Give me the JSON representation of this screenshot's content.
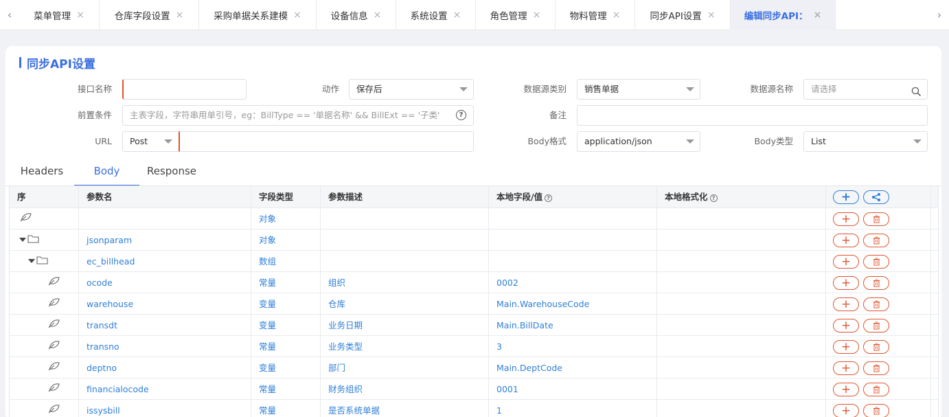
{
  "tabs": [
    {
      "label": "菜单管理",
      "active": false
    },
    {
      "label": "仓库字段设置",
      "active": false
    },
    {
      "label": "采购单据关系建模",
      "active": false
    },
    {
      "label": "设备信息",
      "active": false
    },
    {
      "label": "系统设置",
      "active": false
    },
    {
      "label": "角色管理",
      "active": false
    },
    {
      "label": "物料管理",
      "active": false
    },
    {
      "label": "同步API设置",
      "active": false
    },
    {
      "label": "编辑同步API：",
      "active": true
    }
  ],
  "tab_close_glyph": "×",
  "nav": {
    "prev": "‹",
    "next": "›"
  },
  "title": "同步API设置",
  "form": {
    "api_name_label": "接口名称",
    "api_name_value": "",
    "action_label": "动作",
    "action_value": "保存后",
    "ds_type_label": "数据源类别",
    "ds_type_value": "销售单据",
    "ds_name_label": "数据源名称",
    "ds_name_placeholder": "请选择",
    "precondition_label": "前置条件",
    "precondition_placeholder": "主表字段，字符串用单引号，eg：BillType == '单据名称' && BillExt == '子类'",
    "remark_label": "备注",
    "remark_value": "",
    "url_label": "URL",
    "url_method": "Post",
    "url_value": "",
    "body_format_label": "Body格式",
    "body_format_value": "application/json",
    "body_type_label": "Body类型",
    "body_type_value": "List"
  },
  "subtabs": [
    {
      "label": "Headers",
      "active": false
    },
    {
      "label": "Body",
      "active": true
    },
    {
      "label": "Response",
      "active": false
    }
  ],
  "table": {
    "headers": {
      "seq": "序",
      "name": "参数名",
      "type": "字段类型",
      "desc": "参数描述",
      "local": "本地字段/值",
      "format": "本地格式化"
    },
    "help_glyph": "?",
    "rows": [
      {
        "level": 0,
        "icon": "leaf",
        "name": "",
        "type": "对象",
        "desc": "",
        "local": "",
        "format": ""
      },
      {
        "level": 0,
        "icon": "folder",
        "name": "jsonparam",
        "type": "对象",
        "desc": "",
        "local": "",
        "format": ""
      },
      {
        "level": 1,
        "icon": "folder",
        "name": "ec_billhead",
        "type": "数组",
        "desc": "",
        "local": "",
        "format": ""
      },
      {
        "level": 2,
        "icon": "leaf",
        "name": "ocode",
        "type": "常量",
        "desc": "组织",
        "local": "0002",
        "format": ""
      },
      {
        "level": 2,
        "icon": "leaf",
        "name": "warehouse",
        "type": "变量",
        "desc": "仓库",
        "local": "Main.WarehouseCode",
        "format": ""
      },
      {
        "level": 2,
        "icon": "leaf",
        "name": "transdt",
        "type": "变量",
        "desc": "业务日期",
        "local": "Main.BillDate",
        "format": ""
      },
      {
        "level": 2,
        "icon": "leaf",
        "name": "transno",
        "type": "常量",
        "desc": "业务类型",
        "local": "3",
        "format": ""
      },
      {
        "level": 2,
        "icon": "leaf",
        "name": "deptno",
        "type": "变量",
        "desc": "部门",
        "local": "Main.DeptCode",
        "format": ""
      },
      {
        "level": 2,
        "icon": "leaf",
        "name": "financialocode",
        "type": "常量",
        "desc": "财务组织",
        "local": "0001",
        "format": ""
      },
      {
        "level": 2,
        "icon": "leaf",
        "name": "issysbill",
        "type": "常量",
        "desc": "是否系统单据",
        "local": "1",
        "format": ""
      }
    ]
  },
  "colors": {
    "accent": "#3b6fe0",
    "link": "#2f7fd8",
    "danger": "#e0542e"
  }
}
